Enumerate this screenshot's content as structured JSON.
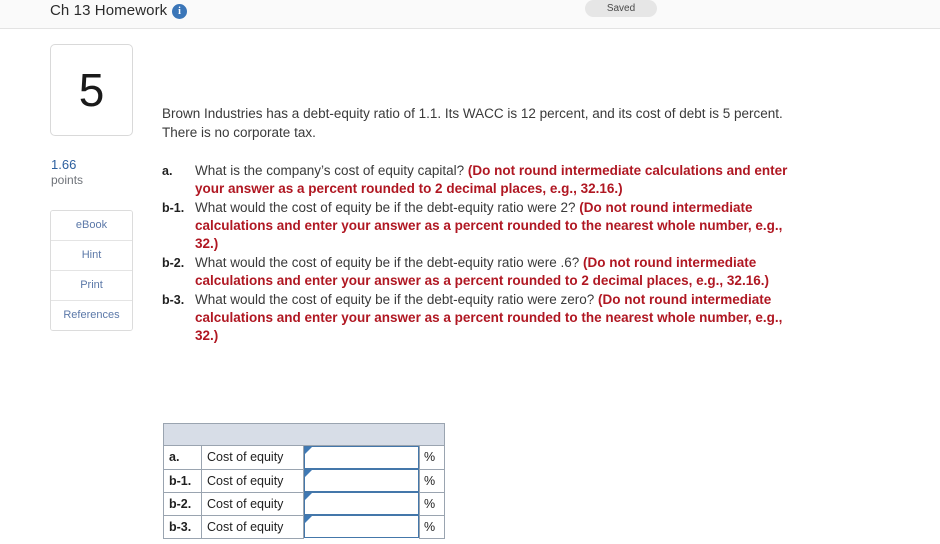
{
  "topbar": {
    "title": "Ch 13 Homework",
    "info_icon": "info-icon",
    "saved_badge": "Saved"
  },
  "rail": {
    "question_number": "5",
    "points_value": "1.66",
    "points_label": "points",
    "tools": [
      {
        "label": "eBook"
      },
      {
        "label": "Hint"
      },
      {
        "label": "Print"
      },
      {
        "label": "References"
      }
    ]
  },
  "main": {
    "stem": "Brown Industries has a debt-equity ratio of 1.1. Its WACC is 12 percent, and its cost of debt is 5 percent. There is no corporate tax.",
    "parts": [
      {
        "label": "a.",
        "question": "What is the company’s cost of equity capital? ",
        "hint": "(Do not round intermediate calculations and enter your answer as a percent rounded to 2 decimal places, e.g., 32.16.)"
      },
      {
        "label": "b-1.",
        "question": "What would the cost of equity be if the debt-equity ratio were 2? ",
        "hint": "(Do not round intermediate calculations and enter your answer as a percent rounded to the nearest whole number, e.g., 32.)"
      },
      {
        "label": "b-2.",
        "question": "What would the cost of equity be if the debt-equity ratio were .6? ",
        "hint": "(Do not round intermediate calculations and enter your answer as a percent rounded to 2 decimal places, e.g., 32.16.)"
      },
      {
        "label": "b-3.",
        "question": "What would the cost of equity be if the debt-equity ratio were zero? ",
        "hint": "(Do not round intermediate calculations and enter your answer as a percent rounded to the nearest whole number, e.g., 32.)"
      }
    ]
  },
  "answer_table": {
    "header_blank": "",
    "rows": [
      {
        "key": "a.",
        "desc": "Cost of equity",
        "value": "",
        "unit": "%"
      },
      {
        "key": "b-1.",
        "desc": "Cost of equity",
        "value": "",
        "unit": "%"
      },
      {
        "key": "b-2.",
        "desc": "Cost of equity",
        "value": "",
        "unit": "%"
      },
      {
        "key": "b-3.",
        "desc": "Cost of equity",
        "value": "",
        "unit": "%"
      }
    ]
  },
  "colors": {
    "hint_red": "#b01722",
    "accent_blue": "#3b76b8",
    "table_header": "#d7dde7",
    "input_border": "#4477aa",
    "points_blue": "#2c5f9e"
  }
}
